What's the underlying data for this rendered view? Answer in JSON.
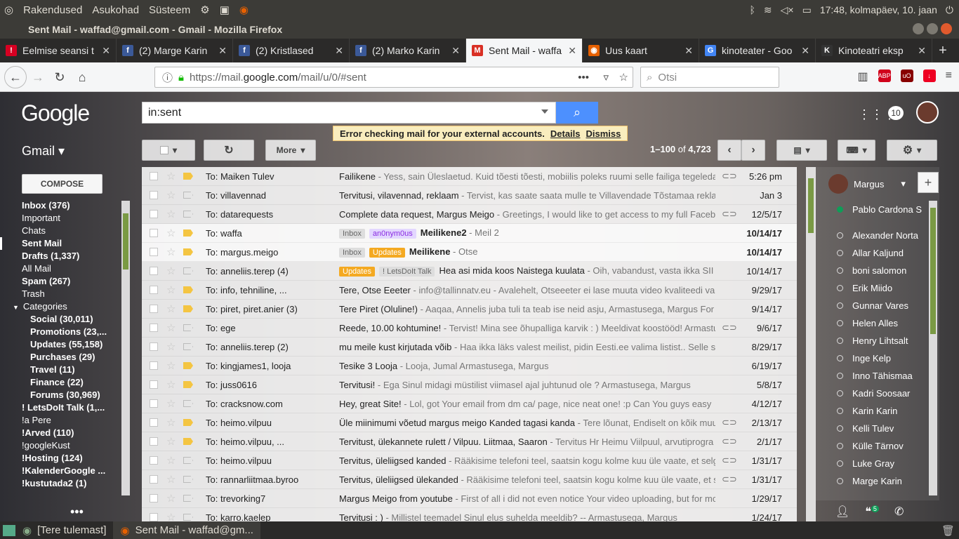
{
  "topbar": {
    "menu": [
      "Rakendused",
      "Asukohad",
      "Süsteem"
    ],
    "clock": "17:48, kolmapäev, 10. jaan"
  },
  "window": {
    "title": "Sent Mail - waffad@gmail.com - Gmail - Mozilla Firefox"
  },
  "tabs": [
    {
      "label": "Eelmise seansi t",
      "icon": "error-icon",
      "color": "#d70022",
      "glyph": "!"
    },
    {
      "label": "(2) Marge Karin",
      "icon": "facebook-icon",
      "color": "#3b5998",
      "glyph": "f"
    },
    {
      "label": "(2) Kristlased",
      "icon": "facebook-icon",
      "color": "#3b5998",
      "glyph": "f"
    },
    {
      "label": "(2) Marko Karin",
      "icon": "facebook-icon",
      "color": "#3b5998",
      "glyph": "f"
    },
    {
      "label": "Sent Mail - waffa",
      "icon": "gmail-icon",
      "color": "#d93025",
      "glyph": "M",
      "active": true
    },
    {
      "label": "Uus kaart",
      "icon": "firefox-icon",
      "color": "#e66000",
      "glyph": "◉"
    },
    {
      "label": "kinoteater - Goo",
      "icon": "google-icon",
      "color": "#4285f4",
      "glyph": "G"
    },
    {
      "label": "Kinoteatri eksp",
      "icon": "k-icon",
      "color": "#333",
      "glyph": "K"
    }
  ],
  "nav": {
    "url_prefix": "https://mail.",
    "url_host": "google.com",
    "url_path": "/mail/u/0/#sent",
    "search_placeholder": "Otsi"
  },
  "gmail": {
    "logo": "Google",
    "search_value": "in:sent",
    "notif_count": "10",
    "error": {
      "text": "Error checking mail for your external accounts.",
      "details": "Details",
      "dismiss": "Dismiss"
    },
    "label": "Gmail",
    "more": "More",
    "compose": "COMPOSE",
    "pager_range": "1–100",
    "pager_of": "of",
    "pager_total": "4,723"
  },
  "leftnav": [
    {
      "label": "Inbox (376)",
      "b": true
    },
    {
      "label": "Important"
    },
    {
      "label": "Chats"
    },
    {
      "label": "Sent Mail",
      "sel": true
    },
    {
      "label": "Drafts (1,337)",
      "b": true
    },
    {
      "label": "All Mail"
    },
    {
      "label": "Spam (267)",
      "b": true
    },
    {
      "label": "Trash"
    },
    {
      "label": "Categories",
      "cat": true
    },
    {
      "label": "Social (30,011)",
      "b": true,
      "sub": true
    },
    {
      "label": "Promotions (23,...",
      "b": true,
      "sub": true
    },
    {
      "label": "Updates (55,158)",
      "b": true,
      "sub": true
    },
    {
      "label": "Purchases (29)",
      "b": true,
      "sub": true
    },
    {
      "label": "Travel (11)",
      "b": true,
      "sub": true
    },
    {
      "label": "Finance (22)",
      "b": true,
      "sub": true
    },
    {
      "label": "Forums (30,969)",
      "b": true,
      "sub": true
    },
    {
      "label": "! LetsDoIt Talk (1,...",
      "b": true
    },
    {
      "label": "!a Pere"
    },
    {
      "label": "!Arved (110)",
      "b": true
    },
    {
      "label": "!googleKust"
    },
    {
      "label": "!Hosting (124)",
      "b": true
    },
    {
      "label": "!KalenderGoogle ...",
      "b": true
    },
    {
      "label": "!kustutada2 (1)",
      "b": true
    }
  ],
  "emails": [
    {
      "to": "To: Maiken Tulev",
      "subject": "Failikene",
      "snippet": " - Yess, sain Üleslaetud. Kuid tõesti tõesti, mobiilis poleks ruumi selle failiga tegeleda",
      "date": "5:26 pm",
      "clip": true,
      "imp": "#f4c542"
    },
    {
      "to": "To: villavennad",
      "subject": "Tervitusi, vilavennad, reklaam",
      "snippet": " - Tervist, kas saate saata mulle te Villavendade Tõstamaa reklaa",
      "date": "Jan 3",
      "imp": "none"
    },
    {
      "to": "To: datarequests",
      "subject": "Complete data request, Margus Meigo",
      "snippet": " - Greetings, I would like to get access to my full Facebo",
      "date": "12/5/17",
      "clip": true,
      "imp": "none"
    },
    {
      "to": "To: waffa",
      "subject": "Meilikene2",
      "snippet": " - Meil 2",
      "date": "10/14/17",
      "unread": true,
      "imp": "#f4c542",
      "labels": [
        {
          "t": "Inbox",
          "bg": "#ddd",
          "fg": "#666"
        },
        {
          "t": "an0nym0us",
          "bg": "#e3d7ff",
          "fg": "#8a2be2"
        }
      ]
    },
    {
      "to": "To: margus.meigo",
      "subject": "Meilikene",
      "snippet": " - Otse",
      "date": "10/14/17",
      "unread": true,
      "imp": "#f4c542",
      "labels": [
        {
          "t": "Inbox",
          "bg": "#ddd",
          "fg": "#666"
        },
        {
          "t": "Updates",
          "bg": "#f4a921",
          "fg": "#fff"
        }
      ]
    },
    {
      "to": "To: anneliis.terep (4)",
      "subject": "Hea asi mida koos Naistega kuulata",
      "snippet": " - Oih, vabandust, vasta ikka SII",
      "date": "10/14/17",
      "imp": "none",
      "labels": [
        {
          "t": "Updates",
          "bg": "#f4a921",
          "fg": "#fff"
        },
        {
          "t": "! LetsDoIt Talk",
          "bg": "#ddd",
          "fg": "#666"
        }
      ]
    },
    {
      "to": "To: info, tehniline, ...",
      "subject": "Tere, Otse Eeeter",
      "snippet": " - info@tallinnatv.eu - Avalehelt, Otseeeter ei lase muuta video kvaliteedi val",
      "date": "9/29/17",
      "imp": "#f4c542"
    },
    {
      "to": "To: piret, piret.anier (3)",
      "subject": "Tere Piret (Oluline!)",
      "snippet": " - Aaqaa, Annelis juba tuli ta teab ise neid asju, Armastusega, Margus For",
      "date": "9/14/17",
      "imp": "#f4c542"
    },
    {
      "to": "To: ege",
      "subject": "Reede, 10.00 kohtumine!",
      "snippet": " - Tervist! Mina see õhupalliga karvik : ) Meeldivat koostööd! Armastu",
      "date": "9/6/17",
      "clip": true,
      "imp": "none"
    },
    {
      "to": "To: anneliis.terep (2)",
      "subject": "mu meile kust kirjutada võib",
      "snippet": " - Haa ikka läks valest meilist, pidin Eesti.ee valima listist.. Selle s",
      "date": "8/29/17",
      "imp": "none"
    },
    {
      "to": "To: kingjames1, looja",
      "subject": "Tesike 3 Looja",
      "snippet": " - Looja, Jumal Armastusega, Margus",
      "date": "6/19/17",
      "imp": "#f4c542"
    },
    {
      "to": "To: juss0616",
      "subject": "Tervitusi!",
      "snippet": " - Ega Sinul midagi müstilist viimasel ajal juhtunud ole ? Armastusega, Margus",
      "date": "5/8/17",
      "imp": "#f4c542"
    },
    {
      "to": "To: cracksnow.com",
      "subject": "Hey, great Site!",
      "snippet": " - Lol, got Your email from dm ca/ page, nice neat one! :p Can You guys easy",
      "date": "4/12/17",
      "imp": "none"
    },
    {
      "to": "To: heimo.vilpuu",
      "subject": "Üle miinimumi võetud margus meigo Kanded tagasi kanda",
      "snippet": " - Tere lõunat, Endiselt on kõik muu",
      "date": "2/13/17",
      "clip": true,
      "imp": "#f4c542"
    },
    {
      "to": "To: heimo.vilpuu, ...",
      "subject": "Tervitust, ülekannete rulett / Vilpuu. Liitmaa, Saaron",
      "snippet": " - Tervitus Hr Heimu Viilpuul, arvutiprogra",
      "date": "2/1/17",
      "clip": true,
      "imp": "#f4c542"
    },
    {
      "to": "To: heimo.vilpuu",
      "subject": "Tervitus, üleliigsed kanded",
      "snippet": " - Rääkisime telefoni teel, saatsin kogu kolme kuu üle vaate, et selg",
      "date": "1/31/17",
      "clip": true,
      "imp": "none"
    },
    {
      "to": "To: rannarliitmaa.byroo",
      "subject": "Tervitus, üleliigsed ülekanded",
      "snippet": " - Rääkisime telefoni teel, saatsin kogu kolme kuu üle vaate, et s",
      "date": "1/31/17",
      "clip": true,
      "imp": "none"
    },
    {
      "to": "To: trevorking7",
      "subject": "Margus Meigo from youtube",
      "snippet": " - First of all i did not even notice Your video uploading, but for mc",
      "date": "1/29/17",
      "imp": "none"
    },
    {
      "to": "To: karro.kaelep",
      "subject": "Tervitusi : )",
      "snippet": " - Millistel teemadel Sinul elus suhelda meeldib? -- Armastusega, Margus",
      "date": "1/24/17",
      "imp": "none"
    }
  ],
  "chat": {
    "me": "Margus",
    "contacts": [
      {
        "name": "Pablo Cardona S",
        "on": true
      },
      {
        "name": "Alexander Norta",
        "on": false
      },
      {
        "name": "Allar Kaljund",
        "on": false
      },
      {
        "name": "boni salomon",
        "on": false
      },
      {
        "name": "Erik Miido",
        "on": false
      },
      {
        "name": "Gunnar Vares",
        "on": false
      },
      {
        "name": "Helen Alles",
        "on": false
      },
      {
        "name": "Henry Lihtsalt",
        "on": false
      },
      {
        "name": "Inge Kelp",
        "on": false
      },
      {
        "name": "Inno Tähismaa",
        "on": false
      },
      {
        "name": "Kadri Soosaar",
        "on": false
      },
      {
        "name": "Karin Karin",
        "on": false
      },
      {
        "name": "Kelli Tulev",
        "on": false
      },
      {
        "name": "Külle Tärnov",
        "on": false
      },
      {
        "name": "Luke Gray",
        "on": false
      },
      {
        "name": "Marge Karin",
        "on": false
      }
    ],
    "hangout_badge": "5"
  },
  "taskbar": [
    {
      "label": "[Tere tulemast]"
    },
    {
      "label": "Sent Mail - waffad@gm...",
      "active": true
    }
  ]
}
